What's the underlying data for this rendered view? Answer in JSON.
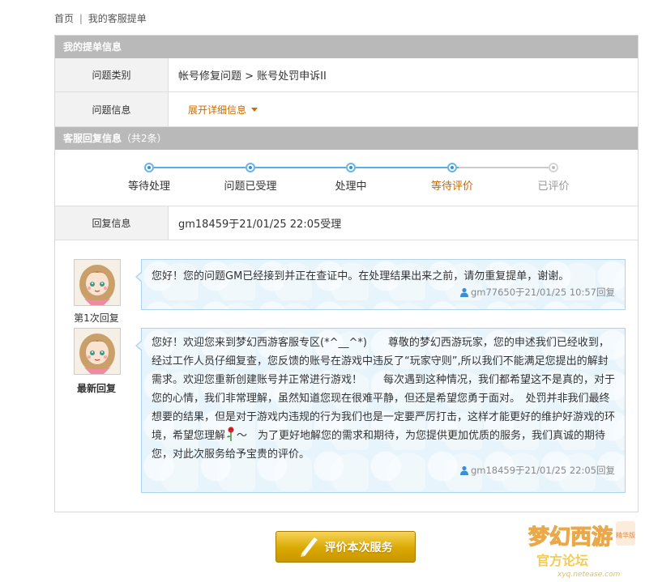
{
  "breadcrumb": {
    "home": "首页",
    "separator": "|",
    "current": "我的客服提单"
  },
  "ticket": {
    "section_title": "我的提单信息",
    "category_label": "问题类别",
    "category_value": "帐号修复问题 > 账号处罚申诉II",
    "info_label": "问题信息",
    "expand_link": "展开详细信息"
  },
  "replies_header": {
    "title": "客服回复信息",
    "count": "（共2条）"
  },
  "progress": {
    "steps": [
      "等待处理",
      "问题已受理",
      "处理中",
      "等待评价",
      "已评价"
    ],
    "current_index": 3
  },
  "reply_info": {
    "label": "回复信息",
    "value": "gm18459于21/01/25 22:05受理"
  },
  "messages": [
    {
      "caption": "第1次回复",
      "text": "您好！您的问题GM已经接到并正在查证中。在处理结果出来之前，请勿重复提单，谢谢。",
      "meta": "gm77650于21/01/25 10:57回复"
    },
    {
      "caption": "最新回复",
      "text": "您好！欢迎您来到梦幻西游客服专区(*^__^*)　　尊敬的梦幻西游玩家，您的申述我们已经收到，经过工作人员仔细复查，您反馈的账号在游戏中违反了“玩家守则”,所以我们不能满足您提出的解封需求。欢迎您重新创建账号并正常进行游戏！　　每次遇到这种情况，我们都希望这不是真的，对于您的心情，我们非常理解，虽然知道您现在很难平静，但还是希望您勇于面对。　处罚并非我们最终想要的结果，但是对于游戏内违规的行为我们也是一定要严厉打击，这样才能更好的维护好游戏的环境，希望您理解",
      "text_tail": "～　为了更好地解您的需求和期待，为您提供更加优质的服务，我们真诚的期待您，对此次服务给予宝贵的评价。",
      "meta": "gm18459于21/01/25 22:05回复"
    }
  ],
  "rate_button": "评价本次服务",
  "watermark": {
    "line1": "梦幻西游",
    "line2": "官方论坛",
    "line3": "xyq.netease.com",
    "tag": "精华版"
  },
  "colors": {
    "header_bg": "#b9b9b9",
    "accent_orange": "#c46a00",
    "bubble_bg": "#e8f4fb",
    "button_gold": "#d9a900"
  }
}
